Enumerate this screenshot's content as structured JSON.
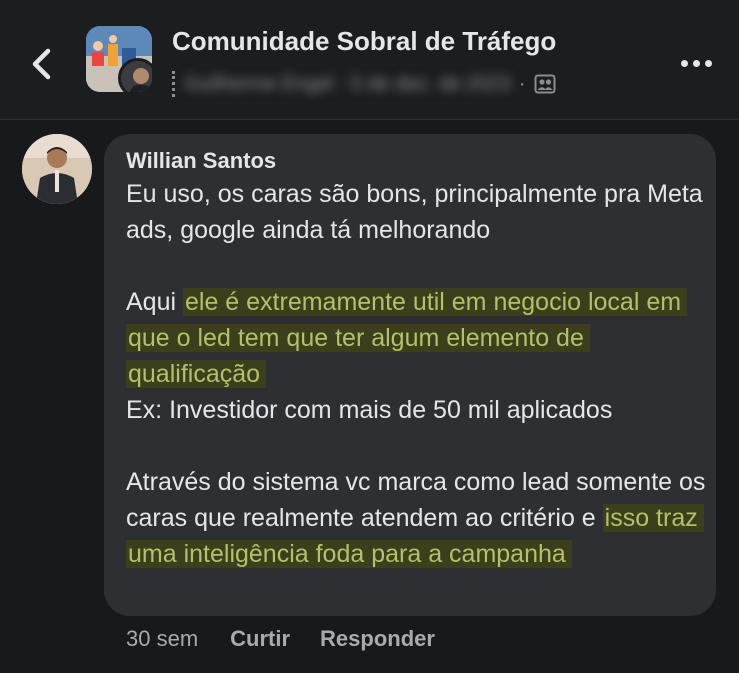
{
  "header": {
    "group_name": "Comunidade Sobral de Tráfego",
    "meta_blurred": "Guilherme Engel · 5 de dez. de 2023",
    "separator": "·"
  },
  "comment": {
    "author": "Willian Santos",
    "lines": {
      "p1": "Eu uso, os caras são bons, principalmente pra Meta ads, google ainda tá melhorando",
      "p2_plain": "Aqui ",
      "p2_highlight": "ele é extremamente util em negocio local em que o led tem que ter algum elemento de qualificação",
      "p3": "Ex: Investidor com mais de 50 mil aplicados",
      "p4_plain": "Através do sistema vc marca como lead somente os caras que realmente atendem ao critério e ",
      "p4_highlight": "isso traz uma inteligência foda para a campanha"
    },
    "highlight_bg": "#3b3f1c",
    "highlight_fg": "#b6bf6a"
  },
  "actions": {
    "time": "30 sem",
    "like": "Curtir",
    "reply": "Responder"
  },
  "icons": {
    "back": "chevron-left-icon",
    "more": "more-dots-icon",
    "audience": "members-icon"
  }
}
